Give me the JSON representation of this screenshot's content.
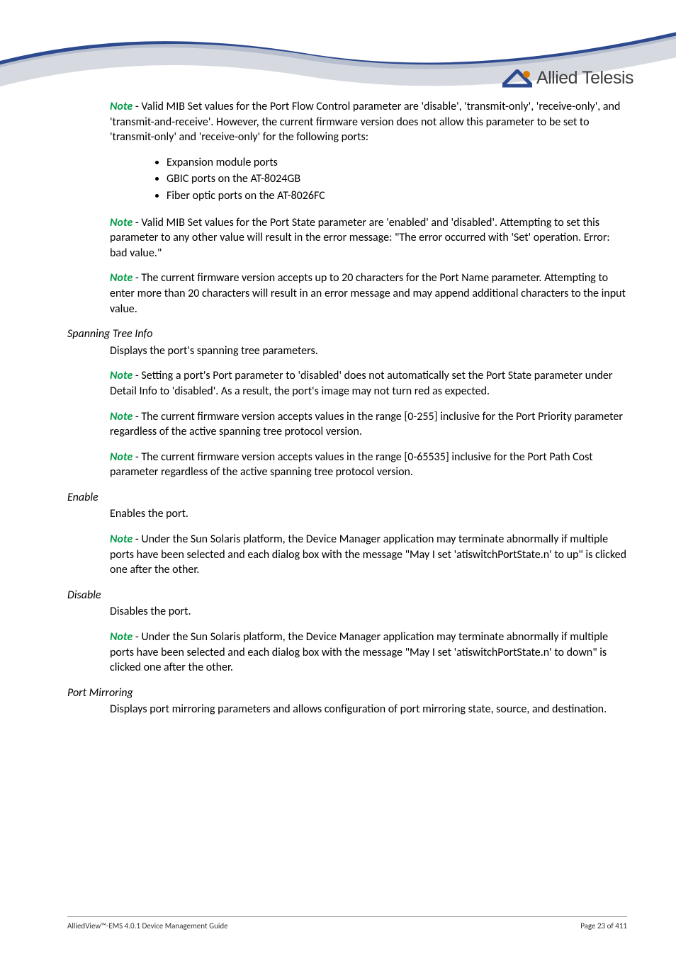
{
  "logo_text": "Allied Telesis",
  "body": {
    "p1a": "Note",
    "p1b": " - Valid MIB Set values for the Port Flow Control parameter are 'disable', 'transmit-only', 'receive-only', and 'transmit-and-receive'. However, the current firmware version does not allow this parameter to be set to 'transmit-only' and 'receive-only' for the following ports:",
    "bullets": {
      "b1": "Expansion module ports",
      "b2": "GBIC ports on the AT-8024GB",
      "b3": "Fiber optic ports on the AT-8026FC"
    },
    "p2a": "Note",
    "p2b": " - Valid MIB Set values for the Port State parameter are 'enabled' and 'disabled'. Attempting to set this parameter to any other value will result in the error message: \"The error occurred with 'Set' operation. Error: bad value.\"",
    "p3a": "Note",
    "p3b": " - The current firmware version accepts up to 20 characters for the Port Name parameter. Attempting to enter more than 20 characters will result in an error message and may append additional characters to the input value.",
    "h1": "Spanning Tree Info",
    "p4": "Displays the port's spanning tree parameters.",
    "p5a": "Note",
    "p5b": " - Setting a port's Port parameter to 'disabled' does not automatically set the Port State parameter under Detail Info to 'disabled'. As a result, the port's image may not turn red as expected.",
    "p6a": "Note",
    "p6b": " - The current firmware version accepts values in the range [0-255] inclusive for the Port Priority parameter regardless of the active spanning tree protocol version.",
    "p7a": "Note",
    "p7b": " - The current firmware version accepts values in the range [0-65535] inclusive for the Port Path Cost parameter regardless of the active spanning tree protocol version.",
    "h2": "Enable",
    "p8": "Enables the port.",
    "p9a": "Note",
    "p9b": " - Under the Sun Solaris platform, the Device Manager application may terminate abnormally if multiple ports have been selected and each dialog box with the message \"May I set 'atiswitchPortState.n' to up\" is clicked one after the other.",
    "h3": "Disable",
    "p10": "Disables the port.",
    "p11a": "Note",
    "p11b": " - Under the Sun Solaris platform, the Device Manager application may terminate abnormally if multiple ports have been selected and each dialog box with the message \"May I set 'atiswitchPortState.n' to down\" is clicked one after the other.",
    "h4": "Port Mirroring",
    "p12": "Displays port mirroring parameters and allows configuration of port mirroring state, source, and destination."
  },
  "footer": {
    "left": "AlliedView™-EMS 4.0.1 Device Management Guide",
    "right": "Page 23 of 411"
  }
}
